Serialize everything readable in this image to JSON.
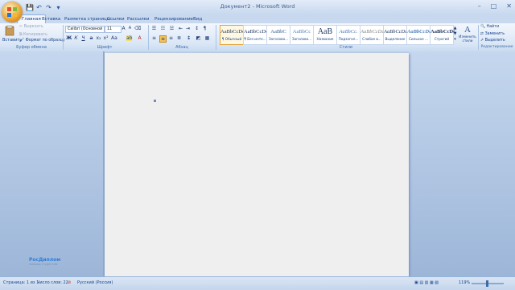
{
  "window": {
    "title": "Документ2 - Microsoft Word",
    "controls": [
      "–",
      "□",
      "✕"
    ]
  },
  "qat": {
    "icons": [
      "save-icon",
      "undo-icon",
      "redo-icon",
      "qat-dropdown-icon"
    ],
    "glyphs": [
      "💾",
      "↶",
      "↷",
      "▾"
    ]
  },
  "tabs": [
    "Главная",
    "Вставка",
    "Разметка страницы",
    "Ссылки",
    "Рассылки",
    "Рецензирование",
    "Вид"
  ],
  "clipboard": {
    "paste": "Вставить",
    "cut": "Вырезать",
    "copy": "Копировать",
    "format_painter": "Формат по образцу",
    "label": "Буфер обмена"
  },
  "font": {
    "name": "Calibri (Основной те",
    "size": "11",
    "label": "Шрифт"
  },
  "paragraph": {
    "label": "Абзац"
  },
  "styles": {
    "label": "Стили",
    "tiles": [
      {
        "sample": "AaBbCcDc",
        "name": "¶ Обычный"
      },
      {
        "sample": "AaBbCcDc",
        "name": "¶ Без инте..."
      },
      {
        "sample": "AaBbC",
        "name": "Заголово..."
      },
      {
        "sample": "AaBbCc",
        "name": "Заголово..."
      },
      {
        "sample": "AaB",
        "name": "Название"
      },
      {
        "sample": "AaBbCc.",
        "name": "Подзагол..."
      },
      {
        "sample": "AaBbCcDc",
        "name": "Слабое в..."
      },
      {
        "sample": "AaBbCcDc",
        "name": "Выделение"
      },
      {
        "sample": "AaBbCcDc",
        "name": "Сильное ..."
      },
      {
        "sample": "AaBbCcDc",
        "name": "Строгий"
      }
    ],
    "change_styles": "Изменить стили"
  },
  "editing": {
    "find": "Найти",
    "replace": "Заменить",
    "select": "Выделить",
    "label": "Редактирование"
  },
  "logo": {
    "name": "РосДиплом",
    "tagline": "помощь студентам"
  },
  "status": {
    "page": "Страница: 1 из 1",
    "words": "Число слов: 22",
    "language": "Русский (Россия)",
    "zoom": "119%"
  }
}
